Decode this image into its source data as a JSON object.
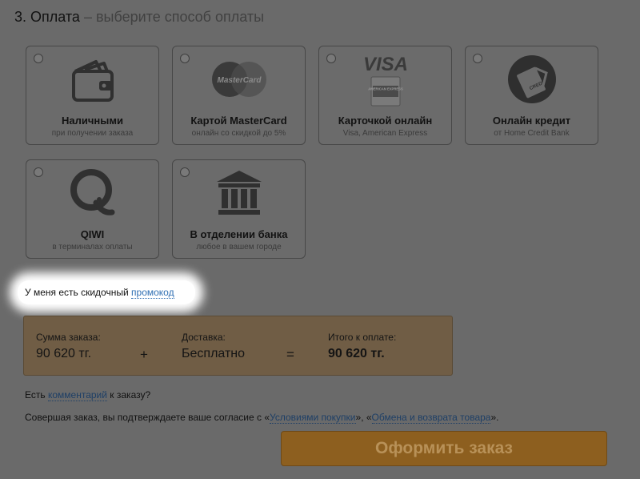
{
  "section": {
    "number": "3. Оплата",
    "subtitle": "– выберите способ оплаты"
  },
  "methods": [
    {
      "title": "Наличными",
      "desc": "при получении заказа",
      "icon": "wallet-icon"
    },
    {
      "title": "Картой MasterCard",
      "desc": "онлайн со скидкой до 5%",
      "icon": "mastercard-icon",
      "logo_text": "MasterCard"
    },
    {
      "title": "Карточкой онлайн",
      "desc": "Visa, American Express",
      "icon": "visa-amex-icon",
      "logo_text": "VISA",
      "logo_text2": "AMERICAN EXPRESS"
    },
    {
      "title": "Онлайн кредит",
      "desc": "от Home Credit Bank",
      "icon": "credit-card-icon",
      "logo_text": "CREDIT"
    },
    {
      "title": "QIWI",
      "desc": "в терминалах оплаты",
      "icon": "qiwi-icon"
    },
    {
      "title": "В отделении банка",
      "desc": "любое в вашем городе",
      "icon": "bank-building-icon"
    }
  ],
  "promo": {
    "text": "У меня есть скидочный",
    "link": "промокод"
  },
  "summary": {
    "order_label": "Сумма заказа:",
    "order_value": "90 620 тг.",
    "plus": "+",
    "delivery_label": "Доставка:",
    "delivery_value": "Бесплатно",
    "equals": "=",
    "total_label": "Итого к оплате:",
    "total_value": "90 620 тг."
  },
  "comment": {
    "before": "Есть",
    "link": "комментарий",
    "after": "к заказу?"
  },
  "agreement": {
    "before": "Совершая заказ, вы подтверждаете ваше согласие с «",
    "link1": "Условиями покупки",
    "middle": "», «",
    "link2": "Обмена и возврата товара",
    "after": "»."
  },
  "submit_label": "Оформить заказ",
  "colors": {
    "overlay_bg": "#6a6a6a",
    "link_blue": "#2f6fb3",
    "summary_bg": "#705d45",
    "button_bg": "#8d5f1f"
  }
}
